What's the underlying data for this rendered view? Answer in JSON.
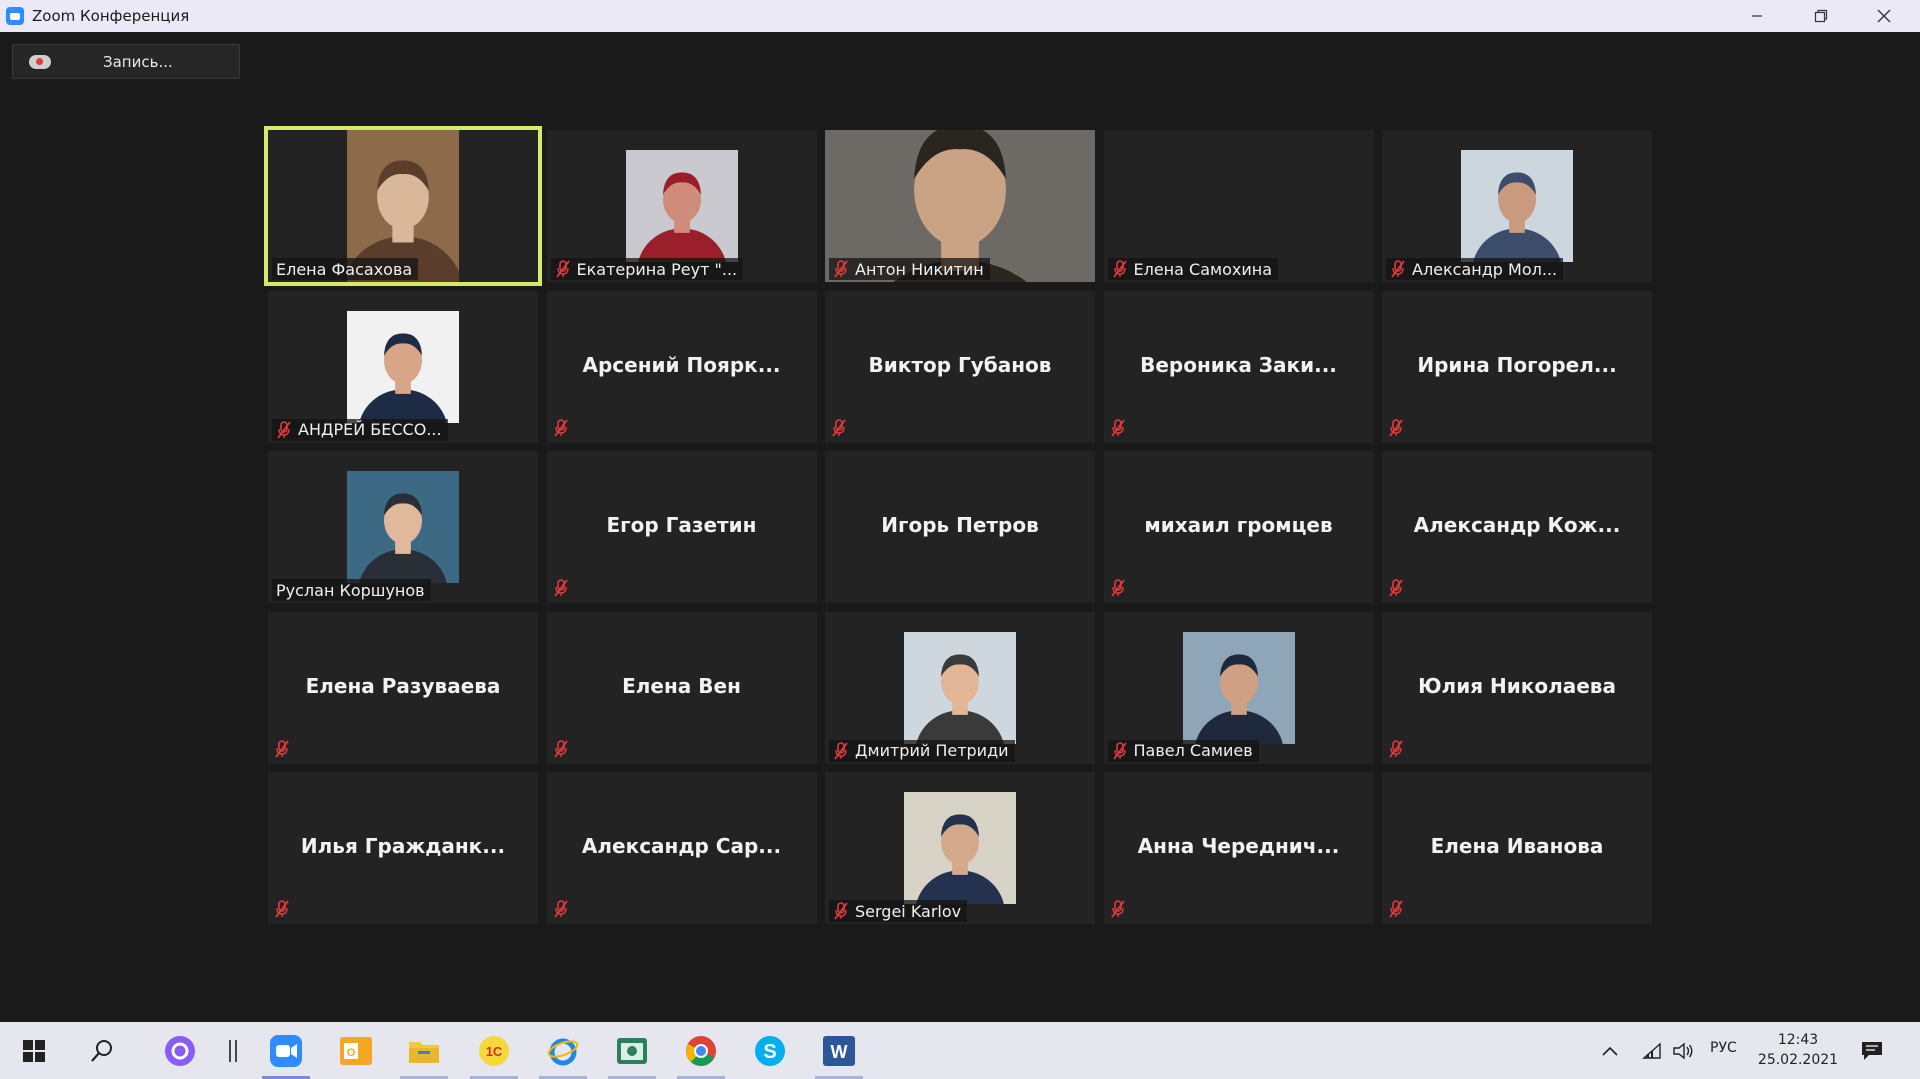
{
  "window": {
    "title": "Zoom Конференция"
  },
  "toolbar": {
    "record_label": "Запись..."
  },
  "participants": [
    {
      "name": "Елена Фасахова",
      "mode": "video",
      "muted": false,
      "active": true
    },
    {
      "name": "Екатерина Реут \"...",
      "mode": "photo",
      "muted": true
    },
    {
      "name": "Антон Никитин",
      "mode": "video",
      "muted": true
    },
    {
      "name": "Елена Самохина",
      "mode": "blank",
      "muted": true
    },
    {
      "name": "Александр Мол...",
      "mode": "photo",
      "muted": true
    },
    {
      "name": "АНДРЕЙ БЕССО...",
      "mode": "photo",
      "muted": true
    },
    {
      "name": "Арсений  Поярк...",
      "mode": "name",
      "muted": true
    },
    {
      "name": "Виктор Губанов",
      "mode": "name",
      "muted": true
    },
    {
      "name": "Вероника  Заки...",
      "mode": "name",
      "muted": true
    },
    {
      "name": "Ирина  Погорел...",
      "mode": "name",
      "muted": true
    },
    {
      "name": "Руслан Коршунов",
      "mode": "photo",
      "muted": false
    },
    {
      "name": "Егор Газетин",
      "mode": "name",
      "muted": true
    },
    {
      "name": "Игорь Петров",
      "mode": "name",
      "muted": false
    },
    {
      "name": "михаил громцев",
      "mode": "name",
      "muted": true
    },
    {
      "name": "Александр  Кож...",
      "mode": "name",
      "muted": true
    },
    {
      "name": "Елена Разуваева",
      "mode": "name",
      "muted": true
    },
    {
      "name": "Елена Вен",
      "mode": "name",
      "muted": true
    },
    {
      "name": "Дмитрий Петриди",
      "mode": "photo",
      "muted": true
    },
    {
      "name": "Павел Самиев",
      "mode": "photo",
      "muted": true
    },
    {
      "name": "Юлия Николаева",
      "mode": "name",
      "muted": true
    },
    {
      "name": "Илья  Гражданк...",
      "mode": "name",
      "muted": true
    },
    {
      "name": "Александр  Сар...",
      "mode": "name",
      "muted": true
    },
    {
      "name": "Sergei Karlov",
      "mode": "photo",
      "muted": true
    },
    {
      "name": "Анна  Череднич...",
      "mode": "name",
      "muted": true
    },
    {
      "name": "Елена Иванова",
      "mode": "name",
      "muted": true
    }
  ],
  "taskbar": {
    "apps": [
      "start",
      "search",
      "cortana",
      "zoom",
      "outlook",
      "explorer",
      "1c",
      "ie",
      "app",
      "chrome",
      "skype",
      "word"
    ],
    "lang": "РУС",
    "time": "12:43",
    "date": "25.02.2021"
  },
  "colors": {
    "active_speaker": "#d6ea6a",
    "mute_icon": "#e5393b",
    "tile_bg": "#232323"
  }
}
